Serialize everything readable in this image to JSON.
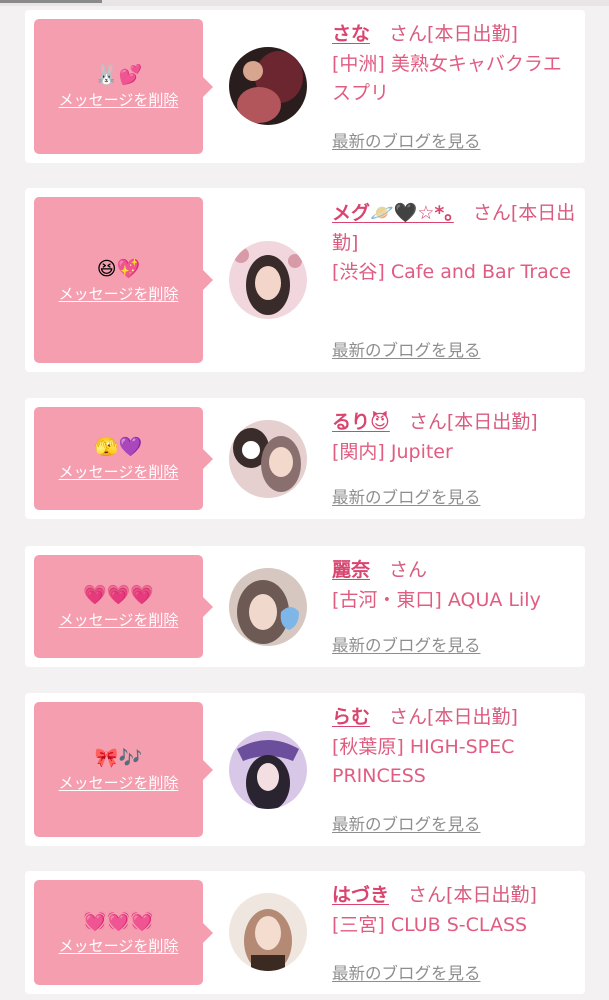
{
  "cards": [
    {
      "emoji": "🐰💕",
      "delete_label": "メッセージを削除",
      "name": "さな",
      "san_status": "さん[本日出勤]",
      "shop": "[中洲] 美熟女キャバクラエスプリ",
      "blog_label": "最新のブログを見る",
      "avatar_colors": [
        "#2a1d1d",
        "#6b2630",
        "#b3565c"
      ]
    },
    {
      "emoji": "😆💖",
      "delete_label": "メッセージを削除",
      "name": "メグ🪐🖤☆*。",
      "san_status": "さん[本日出勤]",
      "shop": "[渋谷] Cafe and Bar Trace",
      "blog_label": "最新のブログを見る",
      "avatar_colors": [
        "#f1d7dd",
        "#d99aa8",
        "#3a2b2b"
      ]
    },
    {
      "emoji": "🫣💜",
      "delete_label": "メッセージを削除",
      "name": "るり😈",
      "san_status": "さん[本日出勤]",
      "shop": "[関内] Jupiter",
      "blog_label": "最新のブログを見る",
      "avatar_colors": [
        "#3b2c2c",
        "#e5cfcf",
        "#8a6f6f"
      ]
    },
    {
      "emoji": "💗💗💗",
      "delete_label": "メッセージを削除",
      "name": "麗奈",
      "san_status": "さん",
      "shop": "[古河・東口] AQUA Lily",
      "blog_label": "最新のブログを見る",
      "avatar_colors": [
        "#d6c7c0",
        "#6e5a55",
        "#7fb6e8"
      ]
    },
    {
      "emoji": "🎀🎶",
      "delete_label": "メッセージを削除",
      "name": "らむ",
      "san_status": "さん[本日出勤]",
      "shop": "[秋葉原] HIGH-SPEC PRINCESS",
      "blog_label": "最新のブログを見る",
      "avatar_colors": [
        "#6b4f9c",
        "#d9c7e8",
        "#2a2330"
      ]
    },
    {
      "emoji": "💓💓💓",
      "delete_label": "メッセージを削除",
      "name": "はづき",
      "san_status": "さん[本日出勤]",
      "shop": "[三宮] CLUB S-CLASS",
      "blog_label": "最新のブログを見る",
      "avatar_colors": [
        "#efe7df",
        "#b58a75",
        "#3b2a22"
      ]
    }
  ]
}
